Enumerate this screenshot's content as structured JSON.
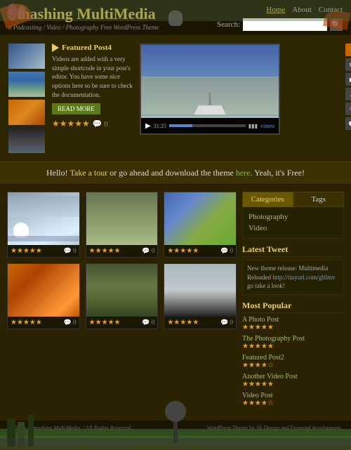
{
  "site": {
    "title": "Smashing MultiMedia",
    "tagline": "a Podcasting / Video / Photography Free WordPress Theme"
  },
  "nav": {
    "home": "Home",
    "about": "About",
    "contact": "Contact",
    "search_label": "Search:",
    "search_placeholder": ""
  },
  "featured": {
    "label": "Featured Post4",
    "description": "Videos are added with a very simple shortcode in your post's editor. You have some nice options here so be sure to check the documentation.",
    "read_more": "READ MORE"
  },
  "hello_bar": {
    "text_before": "Hello! ",
    "tour_link": "Take a tour",
    "text_middle": " or go ahead and download the theme ",
    "here_link": "here",
    "text_after": ". Yeah, it's Free!"
  },
  "video": {
    "time": "31:25",
    "vimeo": "vimeo"
  },
  "categories": {
    "tab_categories": "Categories",
    "tab_tags": "Tags",
    "items": [
      "Photography",
      "Video"
    ]
  },
  "tweet": {
    "title": "Latest Tweet",
    "content": "New theme release: Multimedia Reloaded ",
    "link": "http://tinyurl.com/gltlmv",
    "link_text": "http://tinyurl.com/gltlmv",
    "suffix": " go take a look!"
  },
  "most_popular": {
    "title": "Most Popular",
    "items": [
      {
        "title": "A Photo Post",
        "stars": 5
      },
      {
        "title": "The Photography Post",
        "stars": 5
      },
      {
        "title": "Featured Post2",
        "stars": 4
      },
      {
        "title": "Another Video Post",
        "stars": 5
      },
      {
        "title": "Video Post",
        "stars": 4
      }
    ]
  },
  "footer": {
    "copy": "© 2009 - Smashing MultiMedia. | All Rights Reserved.",
    "credit": "WordPress Theme by Sh Design and Frontend development."
  },
  "stars": "★★★★★"
}
